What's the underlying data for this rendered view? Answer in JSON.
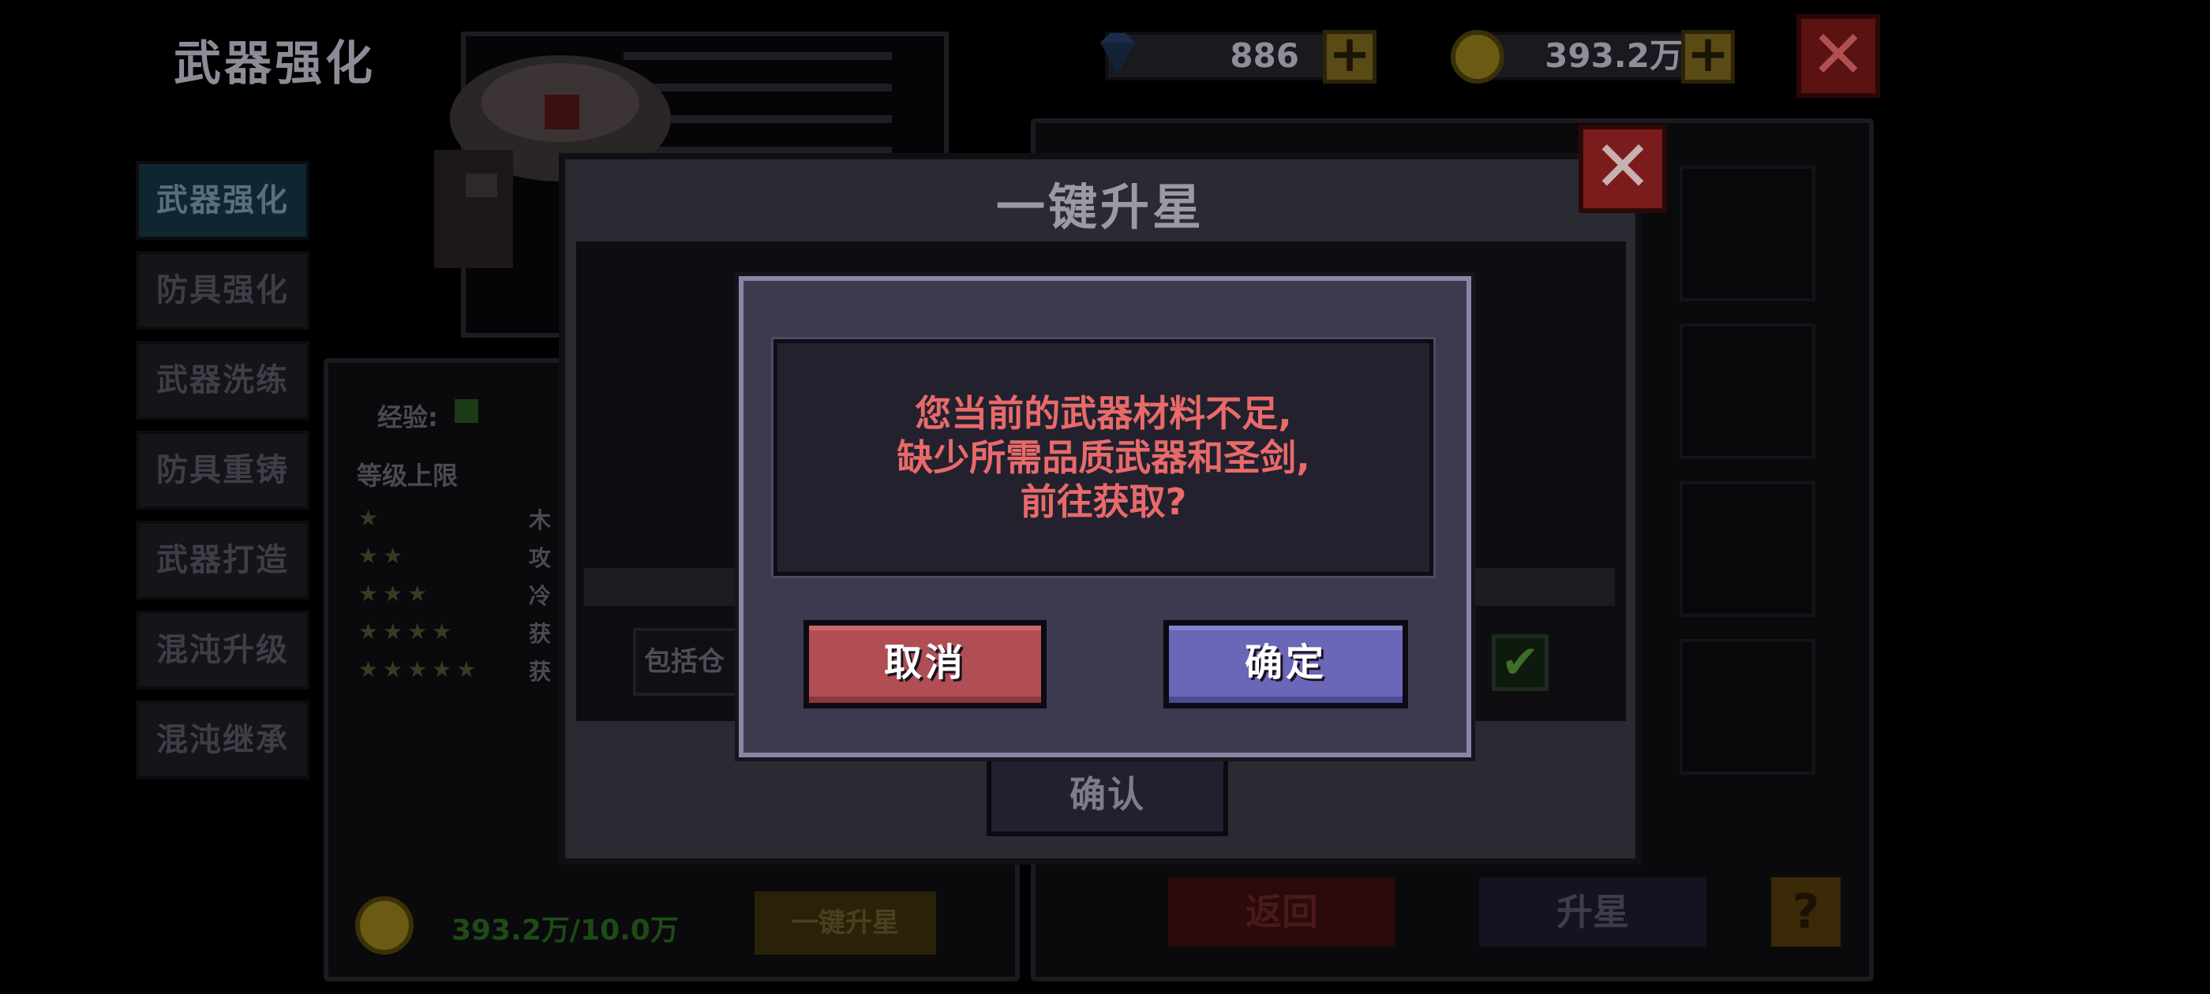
{
  "header": {
    "title": "武器强化",
    "gems": "886",
    "coins": "393.2万",
    "close_icon": "close-icon"
  },
  "sidebar": {
    "items": [
      {
        "label": "武器强化",
        "active": true
      },
      {
        "label": "防具强化"
      },
      {
        "label": "武器洗练"
      },
      {
        "label": "防具重铸"
      },
      {
        "label": "武器打造"
      },
      {
        "label": "混沌升级"
      },
      {
        "label": "混沌继承"
      }
    ]
  },
  "stats": {
    "exp_label": "经验:",
    "level_cap_label": "等级上限",
    "row_labels": [
      "木",
      "攻",
      "冷",
      "获",
      "获"
    ]
  },
  "bottom_left": {
    "cost": "393.2万/10.0万",
    "one_key_star_button": "一键升星"
  },
  "bottom_right": {
    "back_button": "返回",
    "star_up_button": "升星",
    "help_label": "?"
  },
  "modal": {
    "title": "一键升星",
    "include_label": "包括仓",
    "confirm_button": "确认"
  },
  "alert": {
    "line1": "您当前的武器材料不足,",
    "line2": "缺少所需品质武器和圣剑,",
    "line3": "前往获取?",
    "cancel_button": "取消",
    "ok_button": "确定"
  },
  "colors": {
    "alert_text": "#e86a6a",
    "cancel_button": "#b04e54",
    "ok_button": "#6a66b8",
    "alert_panel": "#3c3a4e"
  }
}
